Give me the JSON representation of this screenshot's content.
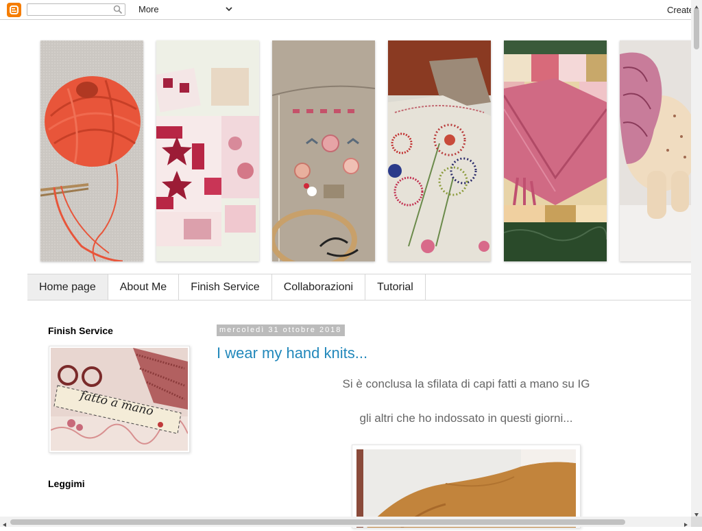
{
  "navbar": {
    "logo_icon": "blogger-logo-icon",
    "search_value": "",
    "search_icon": "search-icon",
    "more_label": "More",
    "create_label": "Create"
  },
  "header": {
    "photos": [
      {
        "name": "header-photo-yarn",
        "subject": "red yarn ball with knitting needles"
      },
      {
        "name": "header-photo-patchwork",
        "subject": "pink patchwork star blocks"
      },
      {
        "name": "header-photo-embroidered-bag",
        "subject": "embroidered linen bag with scissors"
      },
      {
        "name": "header-photo-cross-stitch",
        "subject": "cross stitch flowers pillow"
      },
      {
        "name": "header-photo-knitted-quilt",
        "subject": "pink knitted piece on quilt"
      },
      {
        "name": "header-photo-fabric-elephant",
        "subject": "fabric elephant toy"
      }
    ]
  },
  "tabs": [
    {
      "label": "Home page",
      "active": true
    },
    {
      "label": "About Me",
      "active": false
    },
    {
      "label": "Finish Service",
      "active": false
    },
    {
      "label": "Collaborazioni",
      "active": false
    },
    {
      "label": "Tutorial",
      "active": false
    }
  ],
  "sidebar": {
    "widget1_title": "Finish Service",
    "widget1_image_text": "fatto a mano",
    "widget2_title": "Leggimi"
  },
  "post": {
    "date": "mercoledì 31 ottobre 2018",
    "title": "I wear my hand knits...",
    "line1": "Si è conclusa la sfilata di capi fatti a mano su IG",
    "line2": "gli altri che ho indossato in questi giorni..."
  },
  "colors": {
    "link": "#2288bb",
    "date_bg": "#bbbbbb",
    "tab_active_bg": "#eeeeee",
    "blogger_orange": "#f57d00"
  }
}
